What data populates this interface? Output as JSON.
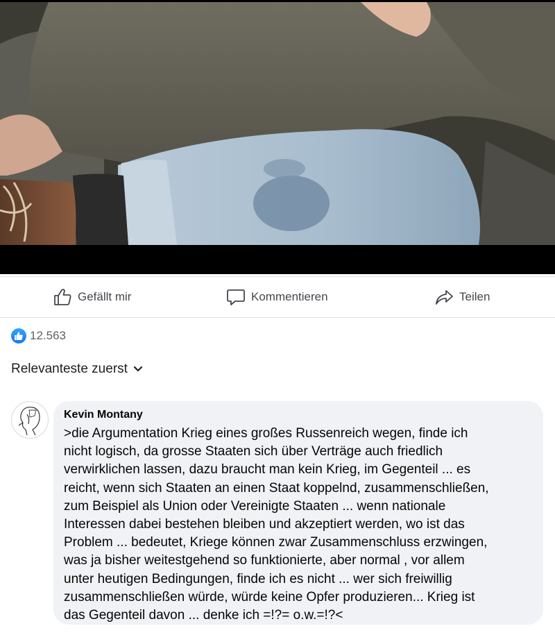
{
  "actions": {
    "like_label": "Gefällt mir",
    "comment_label": "Kommentieren",
    "share_label": "Teilen"
  },
  "reactions": {
    "icon": "like-icon",
    "count": "12.563"
  },
  "sort": {
    "label": "Relevanteste zuerst",
    "icon": "chevron-down-icon"
  },
  "comment": {
    "author": "Kevin Montany",
    "text": ">die Argumentation Krieg eines großes Russenreich wegen, finde ich\nnicht logisch, da grosse Staaten sich über Verträge auch friedlich\nverwirklichen lassen, dazu braucht man kein Krieg, im Gegenteil ... es\nreicht, wenn sich Staaten an einen Staat koppelnd, zusammenschließen,\nzum Beispiel als Union oder Vereinigte Staaten ... wenn nationale\nInteressen dabei bestehen bleiben und akzeptiert werden, wo ist das\nProblem ... bedeutet, Kriege können zwar Zusammenschluss erzwingen,\nwas ja bisher weitestgehend so funktionierte, aber normal , vor allem\nunter heutigen Bedingungen, finde ich es nicht ... wer sich freiwillig\nzusammenschließen würde, würde keine Opfer produzieren... Krieg ist\ndas Gegenteil davon ... denke ich =!?= o.w.=!?<"
  },
  "colors": {
    "like_blue": "#1877f2",
    "bubble_bg": "#f0f2f5",
    "icon_gray": "#44474c"
  }
}
